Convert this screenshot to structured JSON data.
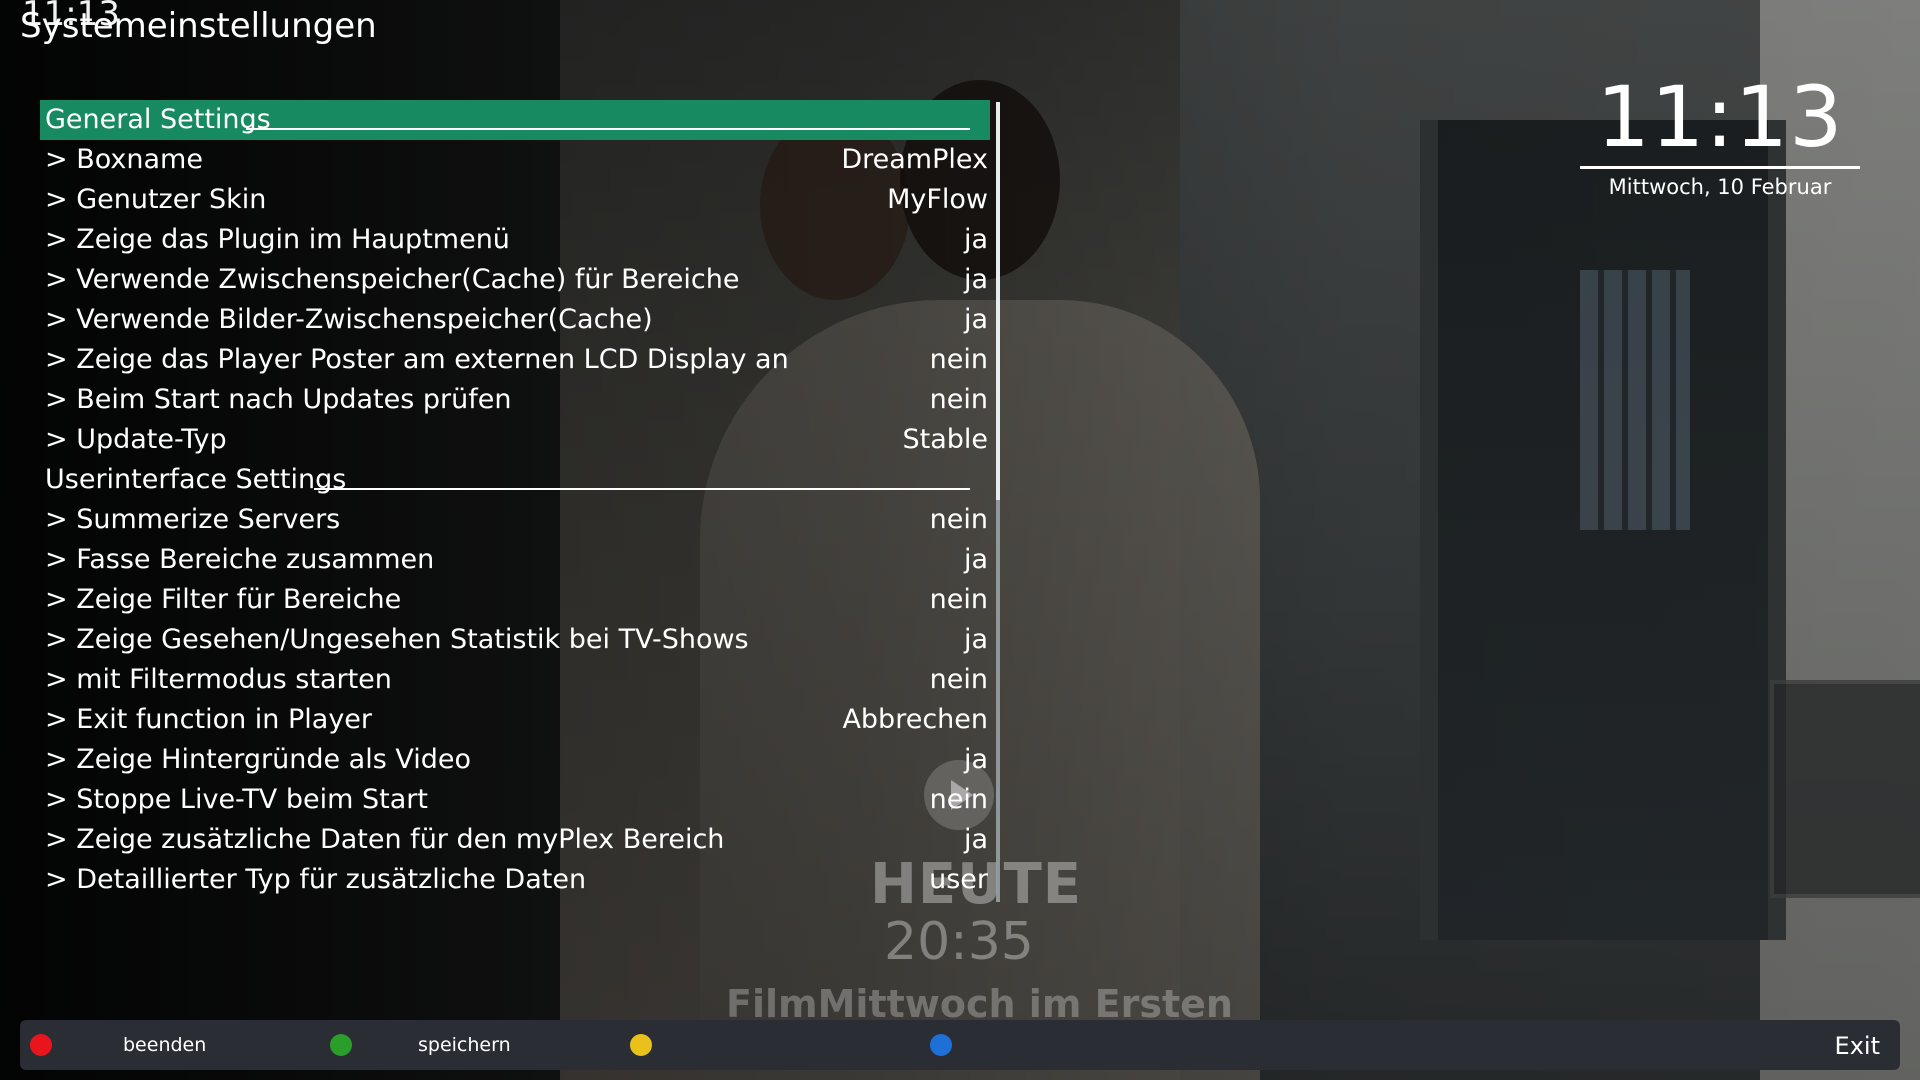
{
  "header": {
    "overlay_clock": "11:13",
    "title": "Systemeinstellungen"
  },
  "clock": {
    "time": "11:13",
    "date": "Mittwoch, 10 Februar"
  },
  "settings": {
    "general_section": "General Settings",
    "rows": [
      {
        "label": "> Boxname",
        "value": "DreamPlex"
      },
      {
        "label": "> Genutzer Skin",
        "value": "MyFlow"
      },
      {
        "label": "> Zeige das Plugin im Hauptmenü",
        "value": "ja"
      },
      {
        "label": "> Verwende Zwischenspeicher(Cache) für Bereiche",
        "value": "ja"
      },
      {
        "label": "> Verwende Bilder-Zwischenspeicher(Cache)",
        "value": "ja"
      },
      {
        "label": "> Zeige das Player Poster am externen LCD Display an",
        "value": "nein"
      },
      {
        "label": "> Beim Start nach Updates prüfen",
        "value": "nein"
      },
      {
        "label": "> Update-Typ",
        "value": "Stable"
      }
    ],
    "ui_section": "Userinterface Settings",
    "ui_rows": [
      {
        "label": "> Summerize Servers",
        "value": "nein"
      },
      {
        "label": "> Fasse Bereiche zusammen",
        "value": "ja"
      },
      {
        "label": "> Zeige Filter für Bereiche",
        "value": "nein"
      },
      {
        "label": "> Zeige Gesehen/Ungesehen Statistik bei TV-Shows",
        "value": "ja"
      },
      {
        "label": "> mit Filtermodus starten",
        "value": "nein"
      },
      {
        "label": "> Exit function in Player",
        "value": "Abbrechen"
      },
      {
        "label": "> Zeige Hintergründe als Video",
        "value": "ja"
      },
      {
        "label": "> Stoppe Live-TV beim Start",
        "value": "nein"
      },
      {
        "label": "> Zeige zusätzliche Daten für den myPlex Bereich",
        "value": "ja"
      },
      {
        "label": "> Detaillierter Typ für zusätzliche Daten",
        "value": "user"
      }
    ]
  },
  "background_promo": {
    "line1": "HEUTE",
    "line2": "20:35",
    "line3": "FilmMittwoch im Ersten"
  },
  "footer": {
    "red_label": "beenden",
    "green_label": "speichern",
    "yellow_label": "",
    "blue_label": "",
    "exit_label": "Exit",
    "colors": {
      "red": "#e8161c",
      "green": "#2a9d2a",
      "yellow": "#e8c21a",
      "blue": "#1e6fd6"
    }
  },
  "colors": {
    "selection": "#178a62",
    "footer_bg": "#2a2d33"
  }
}
